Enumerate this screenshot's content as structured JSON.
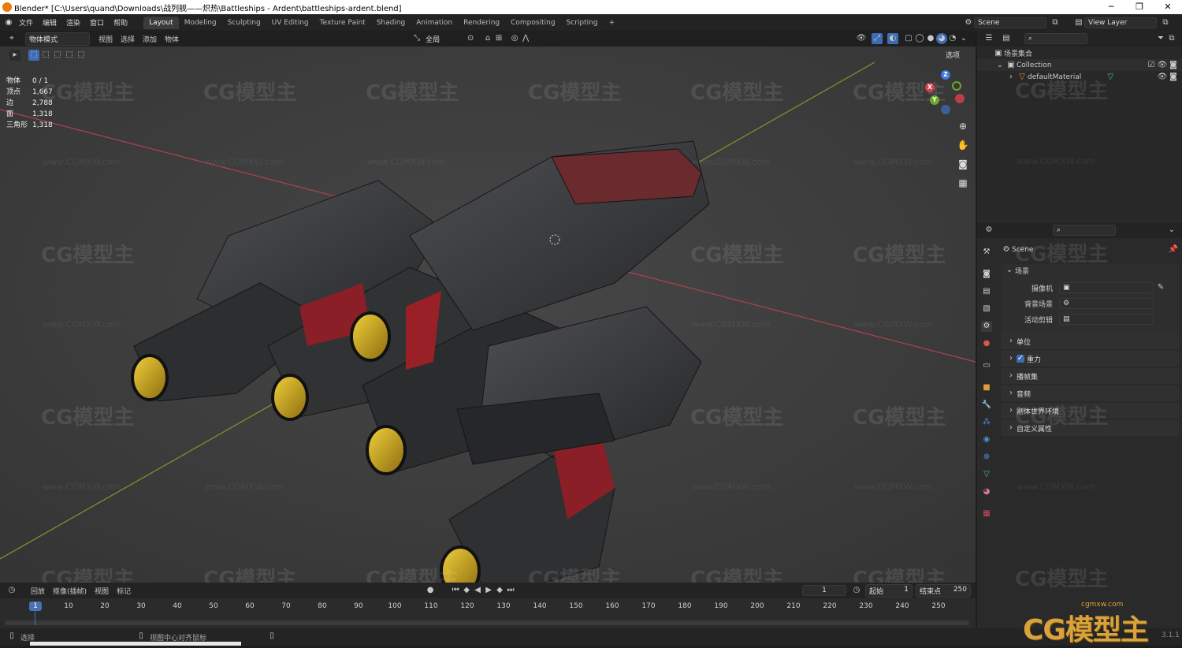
{
  "titlebar": {
    "title": "Blender* [C:\\Users\\quand\\Downloads\\战列舰——炽热\\Battleships - Ardent\\battleships-ardent.blend]",
    "minimize": "─",
    "maximize": "❐",
    "close": "✕"
  },
  "menu": {
    "items": [
      "文件",
      "编辑",
      "渲染",
      "窗口",
      "帮助"
    ],
    "workspaces": [
      "Layout",
      "Modeling",
      "Sculpting",
      "UV Editing",
      "Texture Paint",
      "Shading",
      "Animation",
      "Rendering",
      "Compositing",
      "Scripting"
    ],
    "add_workspace": "+",
    "scene": "Scene",
    "view_layer": "View Layer"
  },
  "viewport_header": {
    "mode": "物体模式",
    "menus": [
      "视图",
      "选择",
      "添加",
      "物体"
    ],
    "transform": "全局",
    "options": "选项"
  },
  "stats": [
    {
      "key": "物体",
      "value": "0 / 1"
    },
    {
      "key": "顶点",
      "value": "1,667"
    },
    {
      "key": "边",
      "value": "2,788"
    },
    {
      "key": "面",
      "value": "1,318"
    },
    {
      "key": "三角形",
      "value": "1,318"
    }
  ],
  "gizmo": {
    "x": "X",
    "y": "Y",
    "z": "Z"
  },
  "watermark": {
    "logo": "CG模型主",
    "url": "www.CGMXW.com",
    "corner_url": "cgmxw.com",
    "corner_logo": "CG模型主",
    "version": "3.1.1"
  },
  "outliner": {
    "root": "场景集合",
    "collection": "Collection",
    "object": "defaultMaterial"
  },
  "properties": {
    "scene_name": "Scene",
    "section": "场景",
    "rows": [
      {
        "label": "摄像机"
      },
      {
        "label": "背景场景"
      },
      {
        "label": "活动剪辑"
      }
    ],
    "panels": [
      "单位",
      "重力",
      "播帧集",
      "音频",
      "刚体世界环境",
      "自定义属性"
    ]
  },
  "timeline": {
    "menus": [
      "回放",
      "抠像(插帧)",
      "视图",
      "标记"
    ],
    "current_frame": "1",
    "start_label": "起始",
    "start": "1",
    "end_label": "结束点",
    "end": "250",
    "ticks": [
      "1",
      "10",
      "20",
      "30",
      "40",
      "50",
      "60",
      "70",
      "80",
      "90",
      "100",
      "110",
      "120",
      "130",
      "140",
      "150",
      "160",
      "170",
      "180",
      "190",
      "200",
      "210",
      "220",
      "230",
      "240",
      "250"
    ]
  },
  "status": {
    "left": "选择",
    "mid": "视图中心对齐鼠标"
  }
}
